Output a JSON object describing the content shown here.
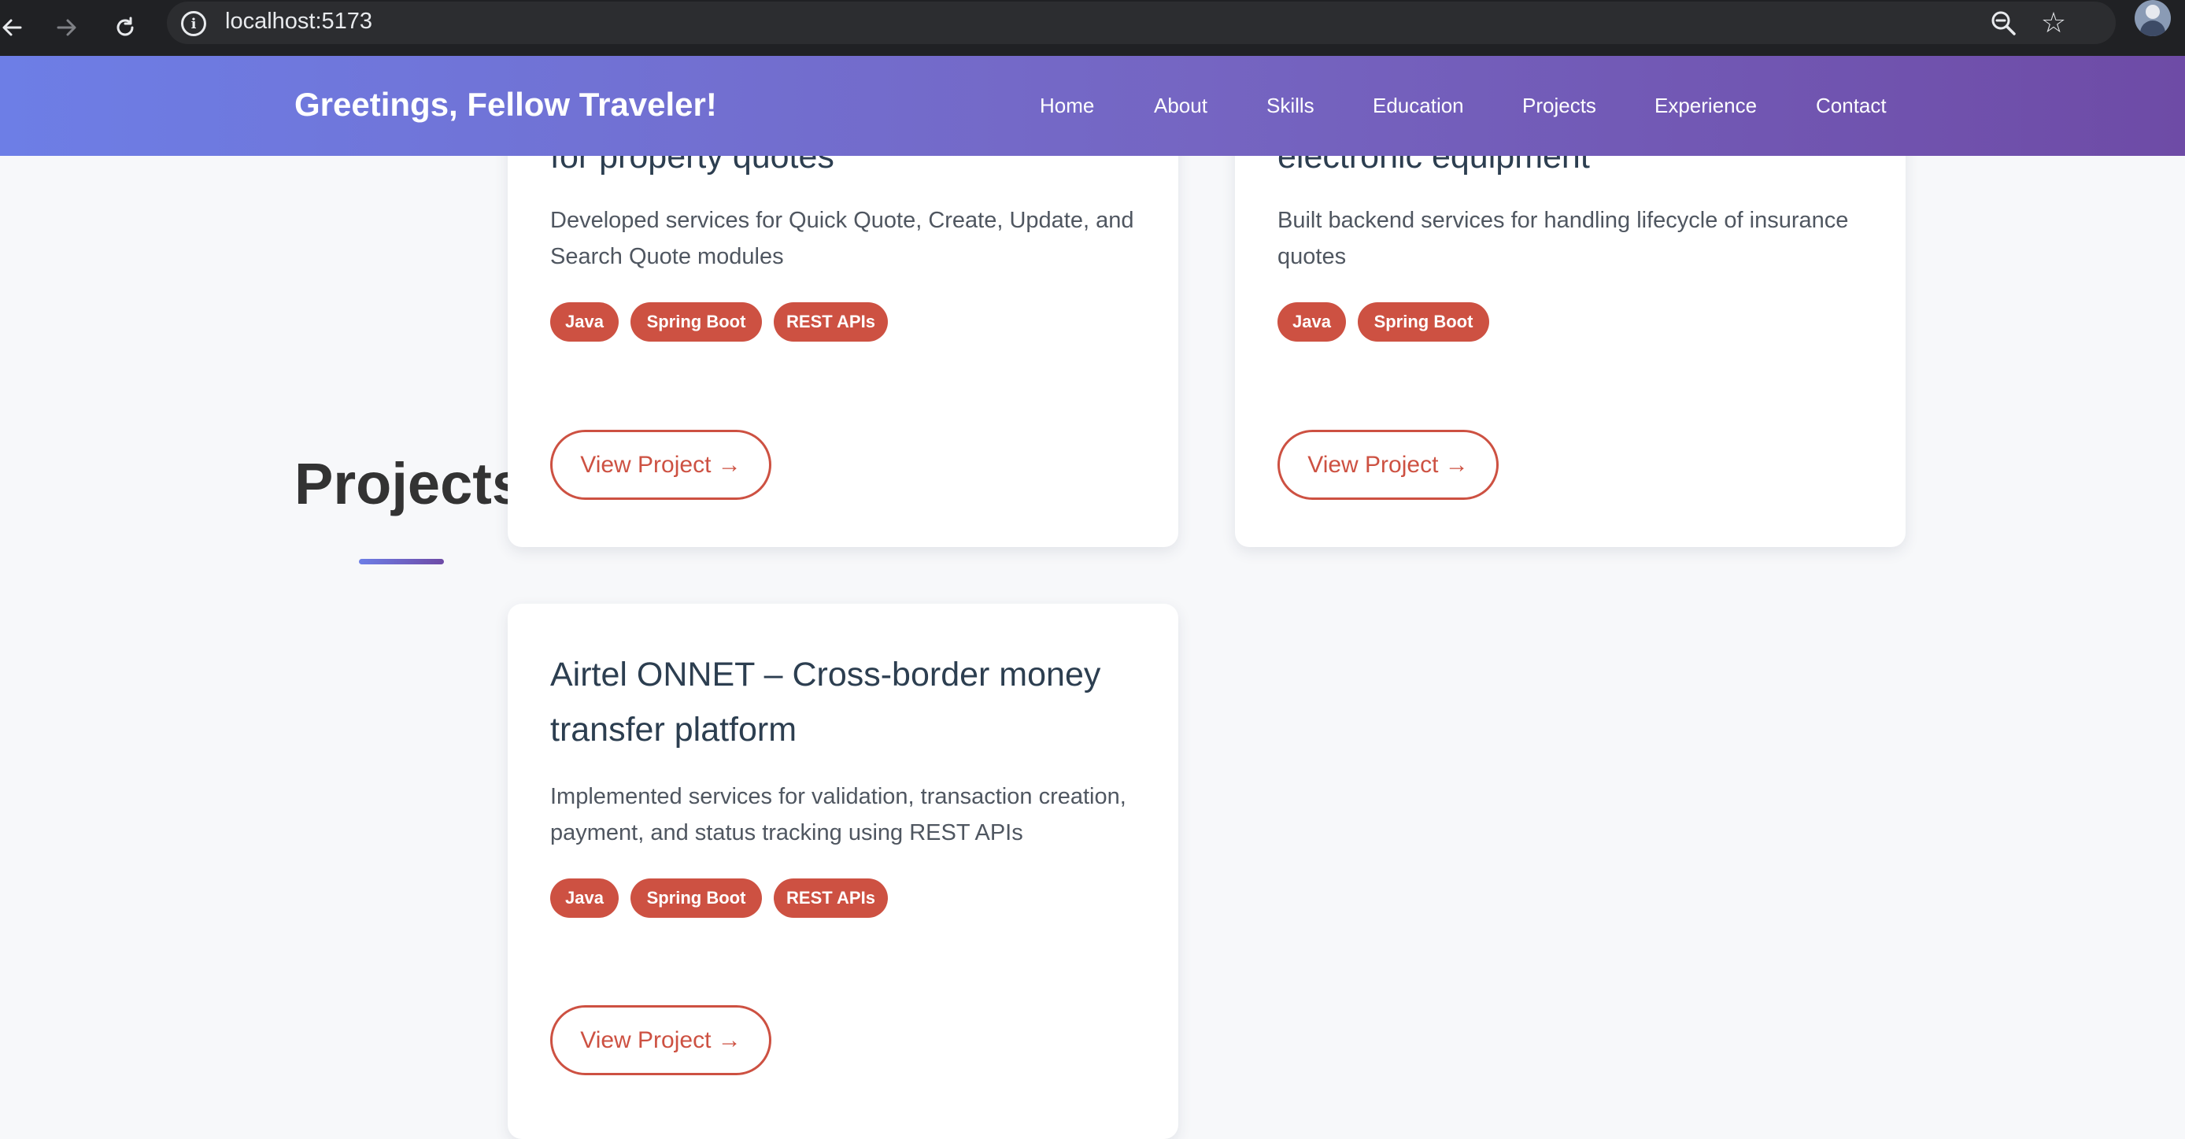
{
  "browser": {
    "url": "localhost:5173",
    "back_icon": "arrow-left",
    "forward_icon": "arrow-right",
    "reload_icon": "reload",
    "info_icon": "i",
    "zoom_icon": "magnifier-minus",
    "star_icon": "☆"
  },
  "header": {
    "brand": "Greetings, Fellow Traveler!",
    "nav": [
      "Home",
      "About",
      "Skills",
      "Education",
      "Projects",
      "Experience",
      "Contact"
    ]
  },
  "projects": {
    "title": "Projects",
    "cards": [
      {
        "title": "for property quotes",
        "description": "Developed services for Quick Quote, Create, Update, and Search Quote modules",
        "tags": [
          "Java",
          "Spring Boot",
          "REST APIs"
        ],
        "button": "View Project →"
      },
      {
        "title": "electronic equipment",
        "description": "Built backend services for handling lifecycle of insurance quotes",
        "tags": [
          "Java",
          "Spring Boot"
        ],
        "button": "View Project →"
      },
      {
        "title": "Airtel ONNET – Cross-border money transfer platform",
        "description": "Implemented services for validation, transaction creation, payment, and status tracking using REST APIs",
        "tags": [
          "Java",
          "Spring Boot",
          "REST APIs"
        ],
        "button": "View Project →"
      }
    ]
  },
  "colors": {
    "header_gradient_start": "#6d7ee6",
    "header_gradient_end": "#6e4ba6",
    "accent": "#cd5142",
    "page_bg": "#f7f8fa",
    "card_title": "#2c3e50"
  }
}
